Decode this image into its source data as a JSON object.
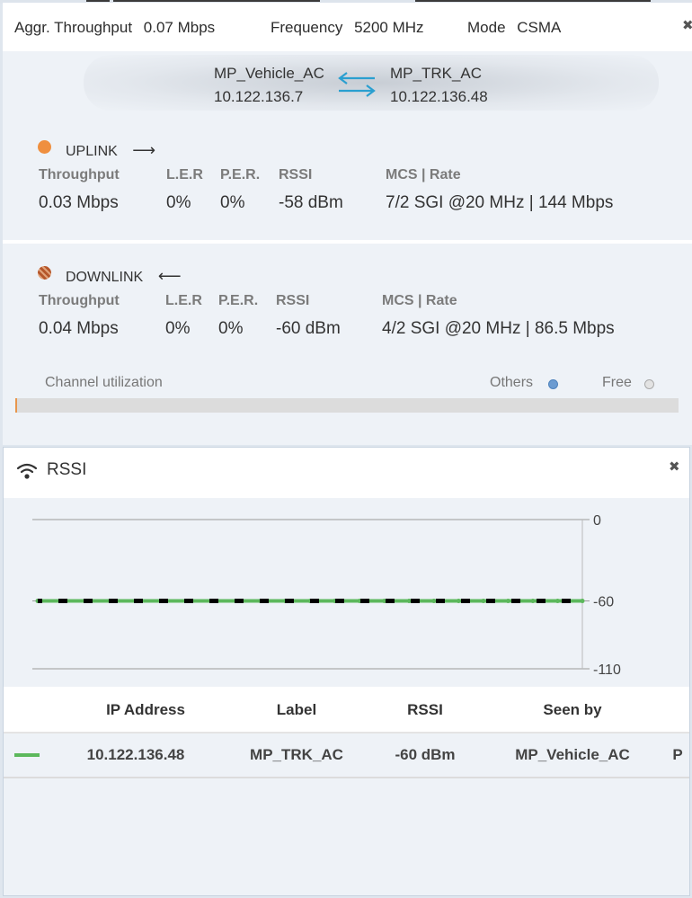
{
  "header": {
    "aggr_label": "Aggr. Throughput",
    "aggr_value": "0.07 Mbps",
    "freq_label": "Frequency",
    "freq_value": "5200 MHz",
    "mode_label": "Mode",
    "mode_value": "CSMA",
    "close": "✖"
  },
  "link": {
    "left_name": "MP_Vehicle_AC",
    "left_ip": "10.122.136.7",
    "right_name": "MP_TRK_AC",
    "right_ip": "10.122.136.48"
  },
  "uplink": {
    "title": "UPLINK",
    "arrow": "⟶",
    "color": "#ef8f3f",
    "cols": [
      "Throughput",
      "L.E.R",
      "P.E.R.",
      "RSSI",
      "MCS | Rate"
    ],
    "vals": [
      "0.03 Mbps",
      "0%",
      "0%",
      "-58 dBm",
      "7/2 SGI @20 MHz | 144 Mbps"
    ]
  },
  "downlink": {
    "title": "DOWNLINK",
    "arrow": "⟵",
    "color": "#b5562a",
    "cols": [
      "Throughput",
      "L.E.R",
      "P.E.R.",
      "RSSI",
      "MCS | Rate"
    ],
    "vals": [
      "0.04 Mbps",
      "0%",
      "0%",
      "-60 dBm",
      "4/2 SGI @20 MHz | 86.5 Mbps"
    ]
  },
  "channel": {
    "label": "Channel utilization",
    "others": "Others",
    "free": "Free",
    "others_color": "#6b9bd1",
    "free_color": "#d8d8d8",
    "used_fraction": 0.003
  },
  "rssi_panel": {
    "title": "RSSI",
    "close": "✖"
  },
  "chart_data": {
    "type": "line",
    "ylim": [
      -110,
      0
    ],
    "yticks": [
      {
        "v": 0,
        "label": "0"
      },
      {
        "v": -60,
        "label": "-60"
      },
      {
        "v": -110,
        "label": "-110"
      }
    ],
    "series": [
      {
        "color": "#5cb85c",
        "values": [
          -60,
          -60,
          -60,
          -60,
          -60,
          -60,
          -60,
          -60,
          -60,
          -60,
          -60,
          -60,
          -60,
          -60,
          -60,
          -60,
          -60,
          -60,
          -60,
          -60,
          -60,
          -60,
          -60
        ]
      },
      {
        "color": "#000000",
        "dash": true,
        "values": [
          -60,
          -60,
          -60,
          -60,
          -60,
          -60,
          -60,
          -60,
          -60,
          -60,
          -60,
          -60,
          -60,
          -60,
          -60,
          -60,
          -60,
          -60,
          -60,
          -60,
          -60,
          -60,
          -60
        ]
      }
    ]
  },
  "table": {
    "headers": [
      "IP Address",
      "Label",
      "RSSI",
      "Seen by"
    ],
    "row": {
      "ip": "10.122.136.48",
      "label": "MP_TRK_AC",
      "rssi": "-60 dBm",
      "seen_by": "MP_Vehicle_AC",
      "extra": "P"
    }
  }
}
